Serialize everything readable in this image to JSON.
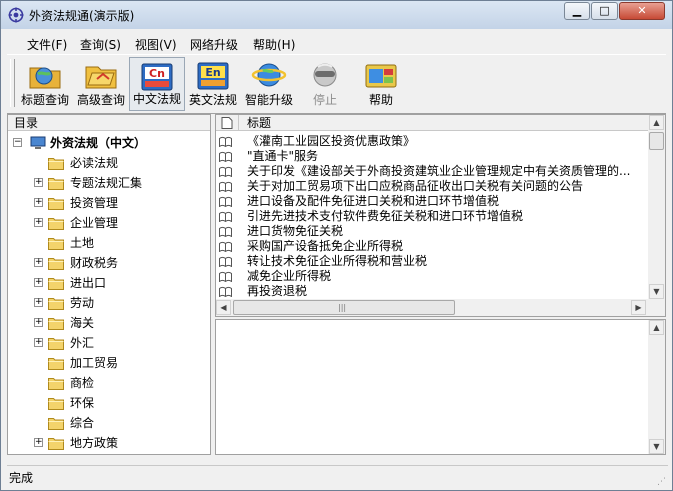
{
  "window": {
    "title": "外资法规通(演示版)",
    "controls": [
      "minimize-icon",
      "maximize-icon",
      "close-icon"
    ]
  },
  "menu": [
    "文件(F)",
    "查询(S)",
    "视图(V)",
    "网络升级",
    "帮助(H)"
  ],
  "toolbar": [
    {
      "label": "标题查询",
      "icon": "title-search-icon",
      "state": "normal"
    },
    {
      "label": "高级查询",
      "icon": "advanced-search-icon",
      "state": "normal"
    },
    {
      "label": "中文法规",
      "icon": "chinese-regulations-icon",
      "state": "pressed"
    },
    {
      "label": "英文法规",
      "icon": "english-regulations-icon",
      "state": "normal"
    },
    {
      "label": "智能升级",
      "icon": "smart-upgrade-icon",
      "state": "normal"
    },
    {
      "label": "停止",
      "icon": "stop-icon",
      "state": "disabled"
    },
    {
      "label": "帮助",
      "icon": "help-icon",
      "state": "normal"
    }
  ],
  "tree": {
    "header": "目录",
    "root": "外资法规（中文）",
    "items": [
      {
        "label": "必读法规",
        "expandable": false
      },
      {
        "label": "专题法规汇集",
        "expandable": true
      },
      {
        "label": "投资管理",
        "expandable": true
      },
      {
        "label": "企业管理",
        "expandable": true
      },
      {
        "label": "土地",
        "expandable": false
      },
      {
        "label": "财政税务",
        "expandable": true
      },
      {
        "label": "进出口",
        "expandable": true
      },
      {
        "label": "劳动",
        "expandable": true
      },
      {
        "label": "海关",
        "expandable": true
      },
      {
        "label": "外汇",
        "expandable": true
      },
      {
        "label": "加工贸易",
        "expandable": false
      },
      {
        "label": "商检",
        "expandable": false
      },
      {
        "label": "环保",
        "expandable": false
      },
      {
        "label": "综合",
        "expandable": false
      },
      {
        "label": "地方政策",
        "expandable": true
      }
    ]
  },
  "list": {
    "header": "标题",
    "rows": [
      "《灌南工业园区投资优惠政策》",
      "\"直通卡\"服务",
      "关于印发《建设部关于外商投资建筑业企业管理规定中有关资质管理的...",
      "关于对加工贸易项下出口应税商品征收出口关税有关问题的公告",
      "进口设备及配件免征进口关税和进口环节增值税",
      "引进先进技术支付软件费免征关税和进口环节增值税",
      "进口货物免征关税",
      "采购国产设备抵免企业所得税",
      "转让技术免征企业所得税和营业税",
      "减免企业所得税",
      "再投资退税"
    ]
  },
  "status": "完成"
}
